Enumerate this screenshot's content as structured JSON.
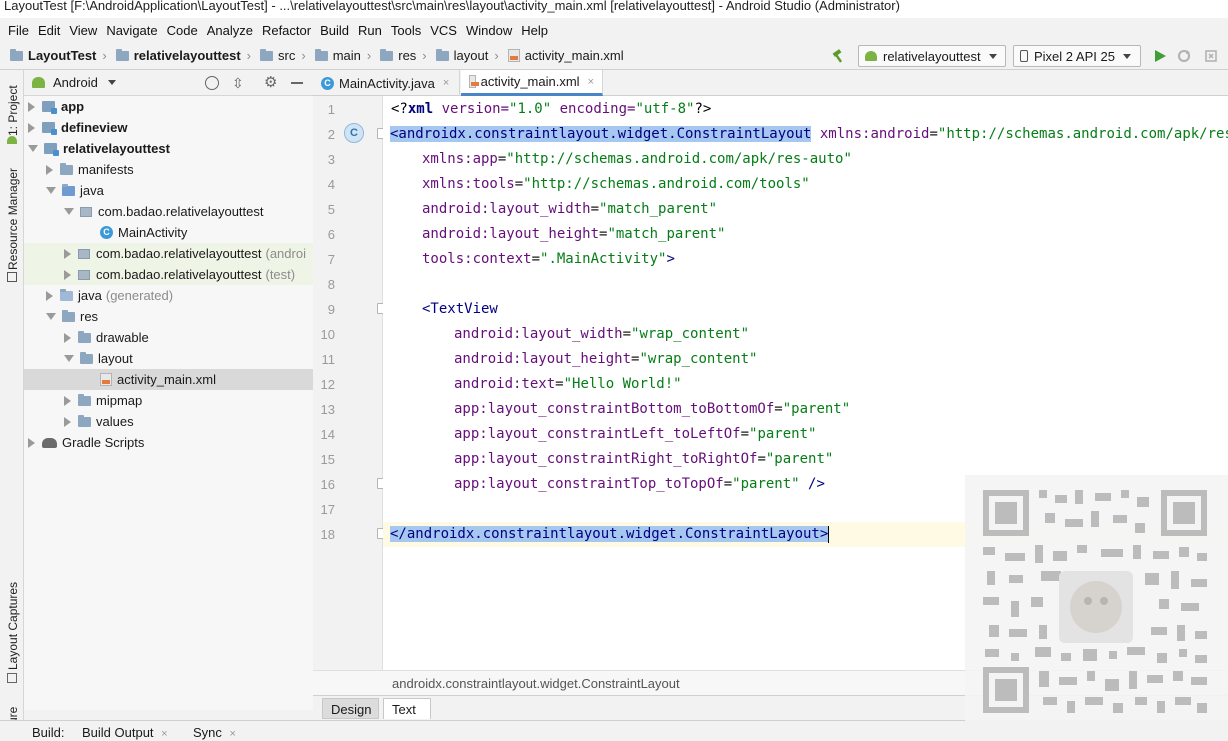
{
  "window": {
    "title": "LayoutTest [F:\\AndroidApplication\\LayoutTest] - ...\\relativelayouttest\\src\\main\\res\\layout\\activity_main.xml [relativelayouttest] - Android Studio (Administrator)"
  },
  "menu": [
    "File",
    "Edit",
    "View",
    "Navigate",
    "Code",
    "Analyze",
    "Refactor",
    "Build",
    "Run",
    "Tools",
    "VCS",
    "Window",
    "Help"
  ],
  "breadcrumb": [
    "LayoutTest",
    "relativelayouttest",
    "src",
    "main",
    "res",
    "layout",
    "activity_main.xml"
  ],
  "toolbar": {
    "run_config": "relativelayouttest",
    "device": "Pixel 2 API 25"
  },
  "side_tabs": {
    "project": "1: Project",
    "resource_manager": "Resource Manager",
    "layout_captures": "Layout Captures",
    "structure": "ucture"
  },
  "project_panel": {
    "view_mode": "Android"
  },
  "tree": [
    {
      "label": "app",
      "bold": true
    },
    {
      "label": "defineview",
      "bold": true
    },
    {
      "label": "relativelayouttest",
      "bold": true
    },
    {
      "label": "manifests"
    },
    {
      "label": "java"
    },
    {
      "label": "com.badao.relativelayouttest"
    },
    {
      "label": "MainActivity"
    },
    {
      "label": "com.badao.relativelayouttest",
      "suffix": "(androi"
    },
    {
      "label": "com.badao.relativelayouttest",
      "suffix": "(test)"
    },
    {
      "label": "java",
      "suffix": "(generated)"
    },
    {
      "label": "res"
    },
    {
      "label": "drawable"
    },
    {
      "label": "layout"
    },
    {
      "label": "activity_main.xml"
    },
    {
      "label": "mipmap"
    },
    {
      "label": "values"
    },
    {
      "label": "Gradle Scripts"
    }
  ],
  "editor_tabs": [
    {
      "label": "MainActivity.java",
      "close": "×"
    },
    {
      "label": "activity_main.xml",
      "close": "×"
    }
  ],
  "code": {
    "line_numbers": [
      "1",
      "2",
      "3",
      "4",
      "5",
      "6",
      "7",
      "8",
      "9",
      "10",
      "11",
      "12",
      "13",
      "14",
      "15",
      "16",
      "17",
      "18"
    ],
    "l1": {
      "open": "<?",
      "name": "xml",
      "a1": " version=",
      "v1": "\"1.0\"",
      "a2": " encoding=",
      "v2": "\"utf-8\"",
      "close": "?>"
    },
    "l2": {
      "tag": "<androidx.constraintlayout.widget.ConstraintLayout",
      "attr": " xmlns:android",
      "eq": "=",
      "val": "\"http://schemas.android.com/apk/res/andr"
    },
    "l3": {
      "attr": "xmlns:app",
      "eq": "=",
      "val": "\"http://schemas.android.com/apk/res-auto\""
    },
    "l4": {
      "attr": "xmlns:tools",
      "eq": "=",
      "val": "\"http://schemas.android.com/tools\""
    },
    "l5": {
      "attr": "android:layout_width",
      "eq": "=",
      "val": "\"match_parent\""
    },
    "l6": {
      "attr": "android:layout_height",
      "eq": "=",
      "val": "\"match_parent\""
    },
    "l7": {
      "attr": "tools:context",
      "eq": "=",
      "val": "\".MainActivity\"",
      "close": ">"
    },
    "l9": {
      "tag": "<TextView"
    },
    "l10": {
      "attr": "android:layout_width",
      "eq": "=",
      "val": "\"wrap_content\""
    },
    "l11": {
      "attr": "android:layout_height",
      "eq": "=",
      "val": "\"wrap_content\""
    },
    "l12": {
      "attr": "android:text",
      "eq": "=",
      "val": "\"Hello World!\""
    },
    "l13": {
      "attr": "app:layout_constraintBottom_toBottomOf",
      "eq": "=",
      "val": "\"parent\""
    },
    "l14": {
      "attr": "app:layout_constraintLeft_toLeftOf",
      "eq": "=",
      "val": "\"parent\""
    },
    "l15": {
      "attr": "app:layout_constraintRight_toRightOf",
      "eq": "=",
      "val": "\"parent\""
    },
    "l16": {
      "attr": "app:layout_constraintTop_toTopOf",
      "eq": "=",
      "val": "\"parent\"",
      "close": " />"
    },
    "l18": {
      "tag": "</androidx.constraintlayout.widget.ConstraintLayout",
      "close": ">"
    }
  },
  "gutter_marker": "C",
  "status_path": "androidx.constraintlayout.widget.ConstraintLayout",
  "bottom_tabs": [
    "Design",
    "Text"
  ],
  "build_bar": {
    "label": "Build:",
    "tabs": [
      {
        "label": "Build Output",
        "close": "×"
      },
      {
        "label": "Sync",
        "close": "×"
      }
    ]
  },
  "colors": {
    "tag": "#000080",
    "attribute": "#660e7a",
    "value": "#067d17",
    "selection": "#a6c8f0",
    "current_line": "#fffae3",
    "tab_underline": "#4a86c7"
  }
}
